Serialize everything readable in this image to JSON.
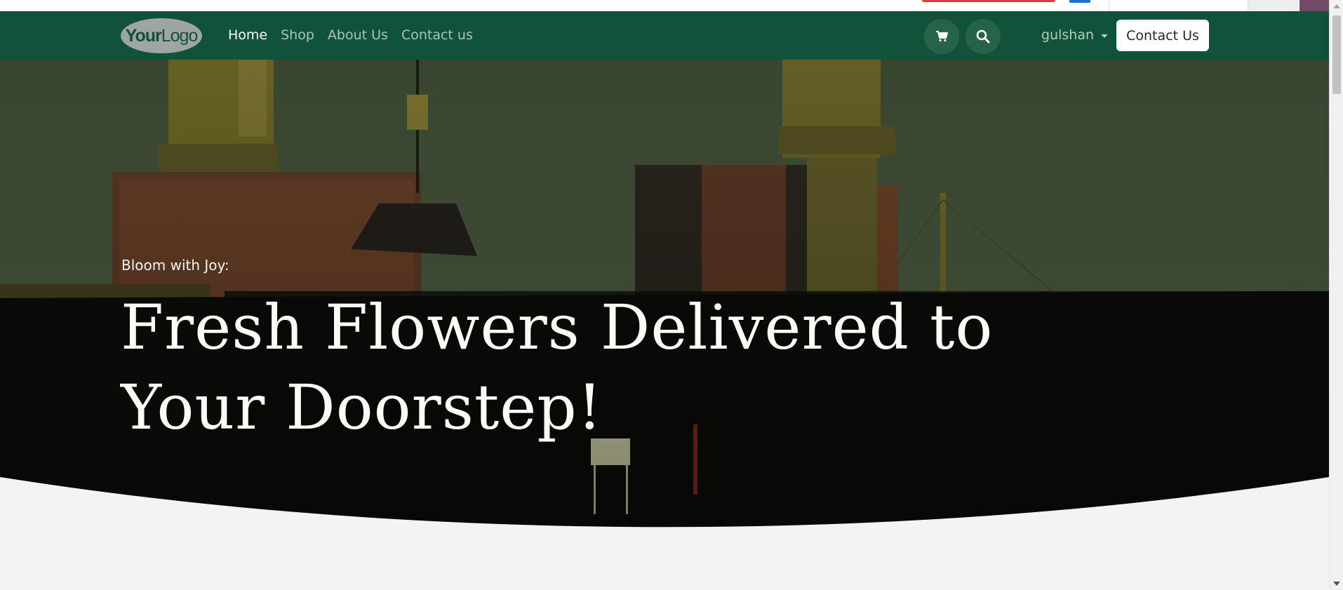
{
  "brand": {
    "logo_bold": "Your",
    "logo_light": "Logo"
  },
  "nav": {
    "items": [
      {
        "label": "Home",
        "active": true
      },
      {
        "label": "Shop",
        "active": false
      },
      {
        "label": "About Us",
        "active": false
      },
      {
        "label": "Contact us",
        "active": false
      }
    ]
  },
  "header_actions": {
    "cart_icon": "cart-icon",
    "search_icon": "search-icon",
    "user_name": "gulshan",
    "contact_button": "Contact Us"
  },
  "hero": {
    "eyebrow": "Bloom with Joy:",
    "headline": "Fresh Flowers Delivered to Your Doorstep!"
  },
  "colors": {
    "header_bg": "#11523a",
    "page_bg": "#f1f4f3",
    "button_bg": "#ffffff"
  }
}
